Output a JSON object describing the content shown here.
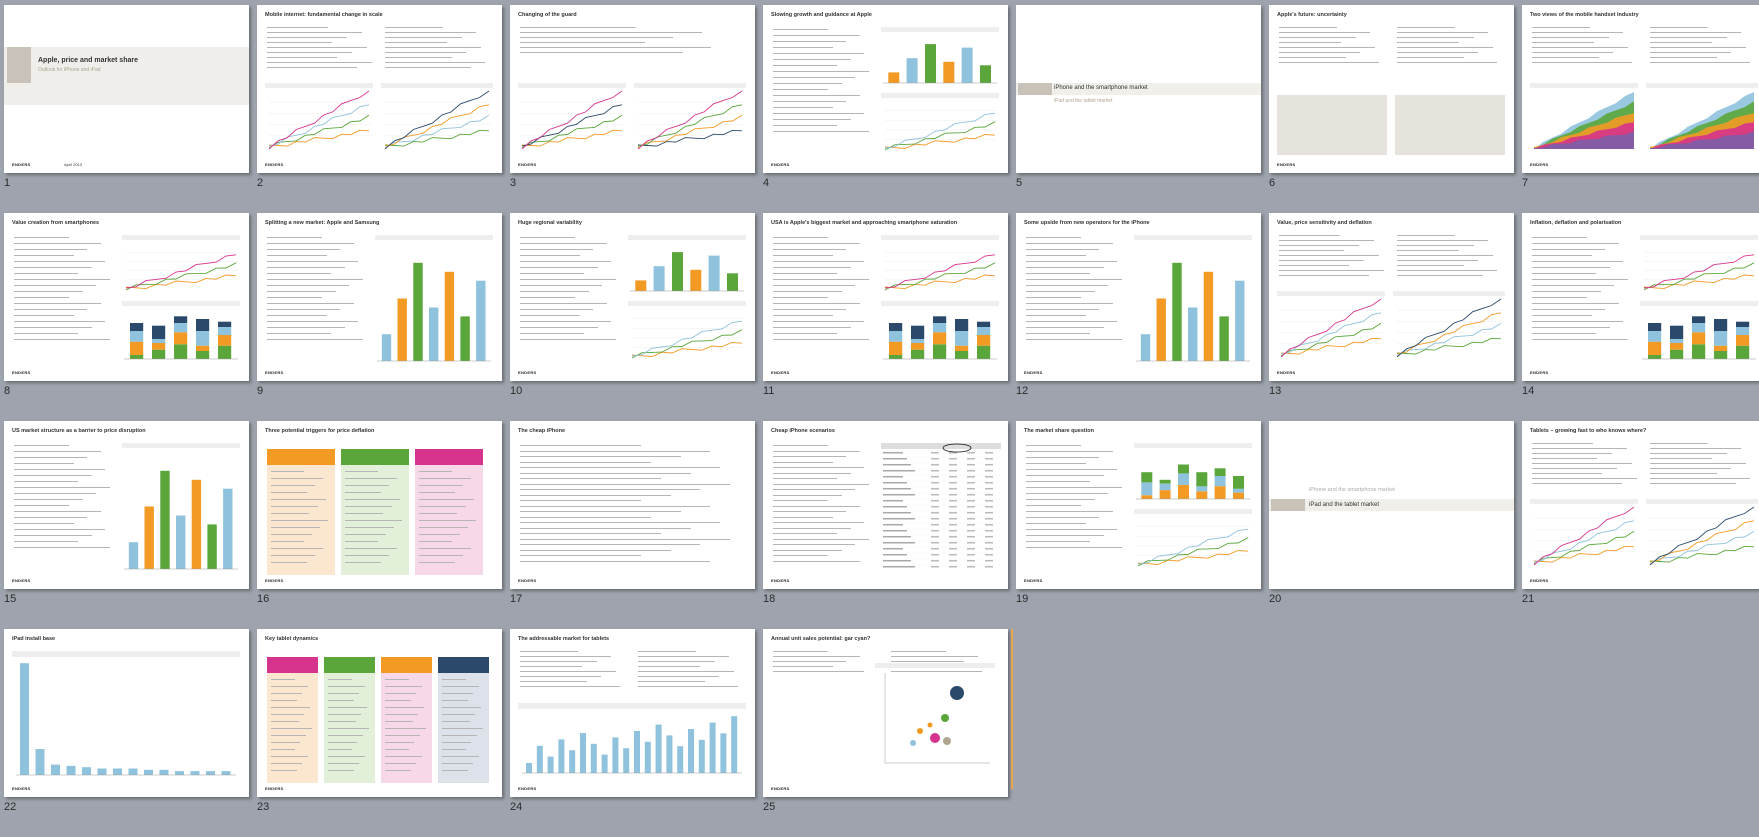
{
  "slides": [
    {
      "num": "1",
      "title": "",
      "kind": "cover",
      "cover_title": "Apple, price and market share",
      "cover_sub": "Outlook for iPhone and iPad",
      "cover_date": "April 2013",
      "footer": "ENDERS"
    },
    {
      "num": "2",
      "title": "Mobile internet: fundamental change in scale",
      "kind": "text2chart",
      "footer": "ENDERS"
    },
    {
      "num": "3",
      "title": "Changing of the guard",
      "kind": "lines2",
      "footer": "ENDERS"
    },
    {
      "num": "4",
      "title": "Slowing growth and guidance at Apple",
      "kind": "textchart",
      "footer": "ENDERS"
    },
    {
      "num": "5",
      "title": "",
      "kind": "divider",
      "divider_main": "iPhone and the smartphone market",
      "divider_sub": "iPad and the tablet market",
      "footer": ""
    },
    {
      "num": "6",
      "title": "Apple's future: uncertainty",
      "kind": "greytext",
      "footer": "ENDERS"
    },
    {
      "num": "7",
      "title": "Two views of the mobile handset industry",
      "kind": "area2",
      "footer": "ENDERS"
    },
    {
      "num": "8",
      "title": "Value creation from smartphones",
      "kind": "textchart",
      "footer": "ENDERS"
    },
    {
      "num": "9",
      "title": "Splitting a new market: Apple and Samsung",
      "kind": "textchart",
      "footer": "ENDERS"
    },
    {
      "num": "10",
      "title": "Huge regional variability",
      "kind": "textchart",
      "footer": "ENDERS"
    },
    {
      "num": "11",
      "title": "USA is Apple's biggest market and approaching smartphone saturation",
      "kind": "textchart",
      "footer": "ENDERS"
    },
    {
      "num": "12",
      "title": "Some upside from new operators for the iPhone",
      "kind": "textchart",
      "footer": "ENDERS"
    },
    {
      "num": "13",
      "title": "Value, price sensitivity and deflation",
      "kind": "text2chart",
      "footer": "ENDERS"
    },
    {
      "num": "14",
      "title": "Inflation, deflation and polarisation",
      "kind": "textchart",
      "footer": "ENDERS"
    },
    {
      "num": "15",
      "title": "US market structure as a barrier to price disruption",
      "kind": "textchart",
      "footer": "ENDERS"
    },
    {
      "num": "16",
      "title": "Three potential triggers for price deflation",
      "kind": "columns3",
      "footer": "ENDERS"
    },
    {
      "num": "17",
      "title": "The cheap iPhone",
      "kind": "text",
      "footer": "ENDERS"
    },
    {
      "num": "18",
      "title": "Cheap iPhone scenarios",
      "kind": "texttable",
      "footer": "ENDERS"
    },
    {
      "num": "19",
      "title": "The market share question",
      "kind": "textchart",
      "footer": "ENDERS"
    },
    {
      "num": "20",
      "title": "",
      "kind": "divider2",
      "divider_top": "iPhone and the smartphone market",
      "divider_main": "iPad and the tablet market",
      "footer": ""
    },
    {
      "num": "21",
      "title": "Tablets – growing fast to who knows where?",
      "kind": "text2chart",
      "footer": "ENDERS"
    },
    {
      "num": "22",
      "title": "iPad install base",
      "kind": "bars",
      "footer": "ENDERS"
    },
    {
      "num": "23",
      "title": "Key tablet dynamics",
      "kind": "columns4",
      "footer": "ENDERS"
    },
    {
      "num": "24",
      "title": "The addressable market for tablets",
      "kind": "textbars",
      "footer": "ENDERS"
    },
    {
      "num": "25",
      "title": "Annual unit sales potential: gar cyan?",
      "kind": "bubble",
      "footer": "ENDERS"
    }
  ],
  "colors": {
    "background": "#9ea3ad",
    "orange": "#f39a25",
    "green": "#5aa63b",
    "blue": "#8fc2dd",
    "navy": "#2b4a6b",
    "pink": "#d6338c",
    "grey_panel": "#e6e2dc"
  }
}
